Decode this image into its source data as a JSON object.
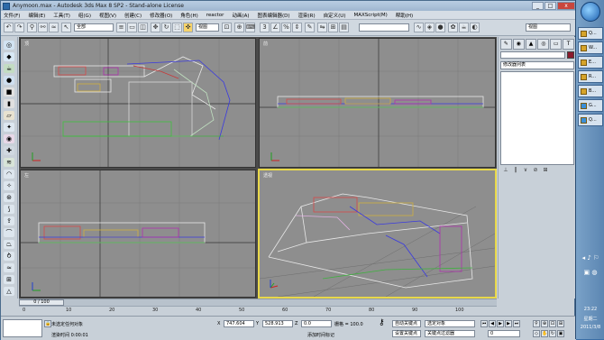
{
  "window": {
    "title": "Anymoon.max - Autodesk 3ds Max 8 SP2 - Stand-alone License",
    "min": "_",
    "max": "□",
    "close": "x"
  },
  "menu": [
    "文件(F)",
    "编辑(E)",
    "工具(T)",
    "组(G)",
    "视图(V)",
    "创建(C)",
    "修改器(O)",
    "角色(H)",
    "reactor",
    "动画(A)",
    "图表编辑器(D)",
    "渲染(R)",
    "自定义(U)",
    "MAXScript(M)",
    "帮助(H)"
  ],
  "toolbar": {
    "filter_select": "全部",
    "refcoord_select": "视图",
    "named_sel_select": "",
    "right_select": "视图"
  },
  "viewports": {
    "top": "顶",
    "front": "前",
    "left": "左",
    "persp": "透视"
  },
  "command_panel": {
    "tabs": [
      "✎",
      "◉",
      "▲",
      "◎",
      "▭",
      "T"
    ],
    "modifier_list": "修改器列表",
    "name_value": "",
    "object_color": "#8a1b2d"
  },
  "timeline": {
    "frame_display": "0 / 100",
    "ruler_ticks": [
      "0",
      "10",
      "20",
      "30",
      "40",
      "50",
      "60",
      "70",
      "80",
      "90",
      "100"
    ]
  },
  "status": {
    "selection": "未选定任何对象",
    "x_label": "X",
    "x_value": "747.604",
    "y_label": "Y",
    "y_value": "528.913",
    "z_label": "Z",
    "z_value": "0.0",
    "grid": "栅格 = 100.0",
    "auto_key": "自动关键点",
    "set_key": "设置关键点",
    "key_mode_select": "选定对象",
    "key_filters": "关键点过滤器",
    "frame_value": "0",
    "prompt": "渲染时间  0:00:01",
    "add_time_tag": "添加时间标记",
    "mini_listener": ""
  },
  "taskbar": {
    "items": [
      "Q...",
      "W...",
      "E...",
      "R...",
      "B...",
      "G...",
      "Q..."
    ],
    "time": "23:22",
    "weekday": "星期二",
    "date": "2011/3/8"
  }
}
